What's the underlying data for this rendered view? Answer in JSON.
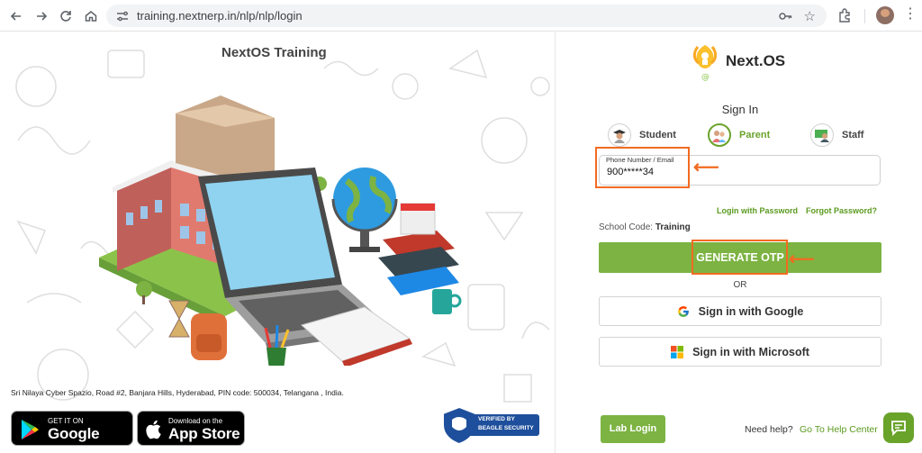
{
  "browser": {
    "url": "training.nextnerp.in/nlp/nlp/login",
    "icons": [
      "back-icon",
      "forward-icon",
      "reload-icon",
      "home-icon",
      "site-info-icon",
      "password-key-icon",
      "bookmark-star-icon",
      "extensions-icon",
      "profile-avatar",
      "more-menu-icon"
    ]
  },
  "left_panel": {
    "title": "NextOS Training",
    "illustration": "school-laptop-globe-books",
    "address": "Sri Nilaya Cyber Spazio, Road #2, Banjara Hills, Hyderabad, PIN code: 500034, Telangana , India.",
    "google_play": {
      "small": "GET IT ON",
      "big": "Google Play"
    },
    "app_store": {
      "small": "Download on the",
      "big": "App Store"
    },
    "badge": {
      "line1": "VERIFIED BY",
      "line2": "BEAGLE SECURITY"
    }
  },
  "brand": {
    "name": "Next OS",
    "name_display": "Next.OS"
  },
  "login": {
    "heading": "Sign In",
    "roles": [
      {
        "label": "Student",
        "active": false
      },
      {
        "label": "Parent",
        "active": true
      },
      {
        "label": "Staff",
        "active": false
      }
    ],
    "phone_label": "Phone Number / Email",
    "phone_value": "900*****34",
    "login_with_password": "Login with Password",
    "forgot_password": "Forgot Password?",
    "school_code_label": "School Code:",
    "school_code_value": "Training",
    "generate_otp": "GENERATE OTP",
    "or": "OR",
    "google_signin": "Sign in with Google",
    "microsoft_signin": "Sign in with Microsoft"
  },
  "footer": {
    "lab_login": "Lab Login",
    "need_help": "Need help?",
    "help_center": "Go To Help Center"
  },
  "colors": {
    "accent_green": "#7cb342",
    "highlight_orange": "#f26b21"
  }
}
